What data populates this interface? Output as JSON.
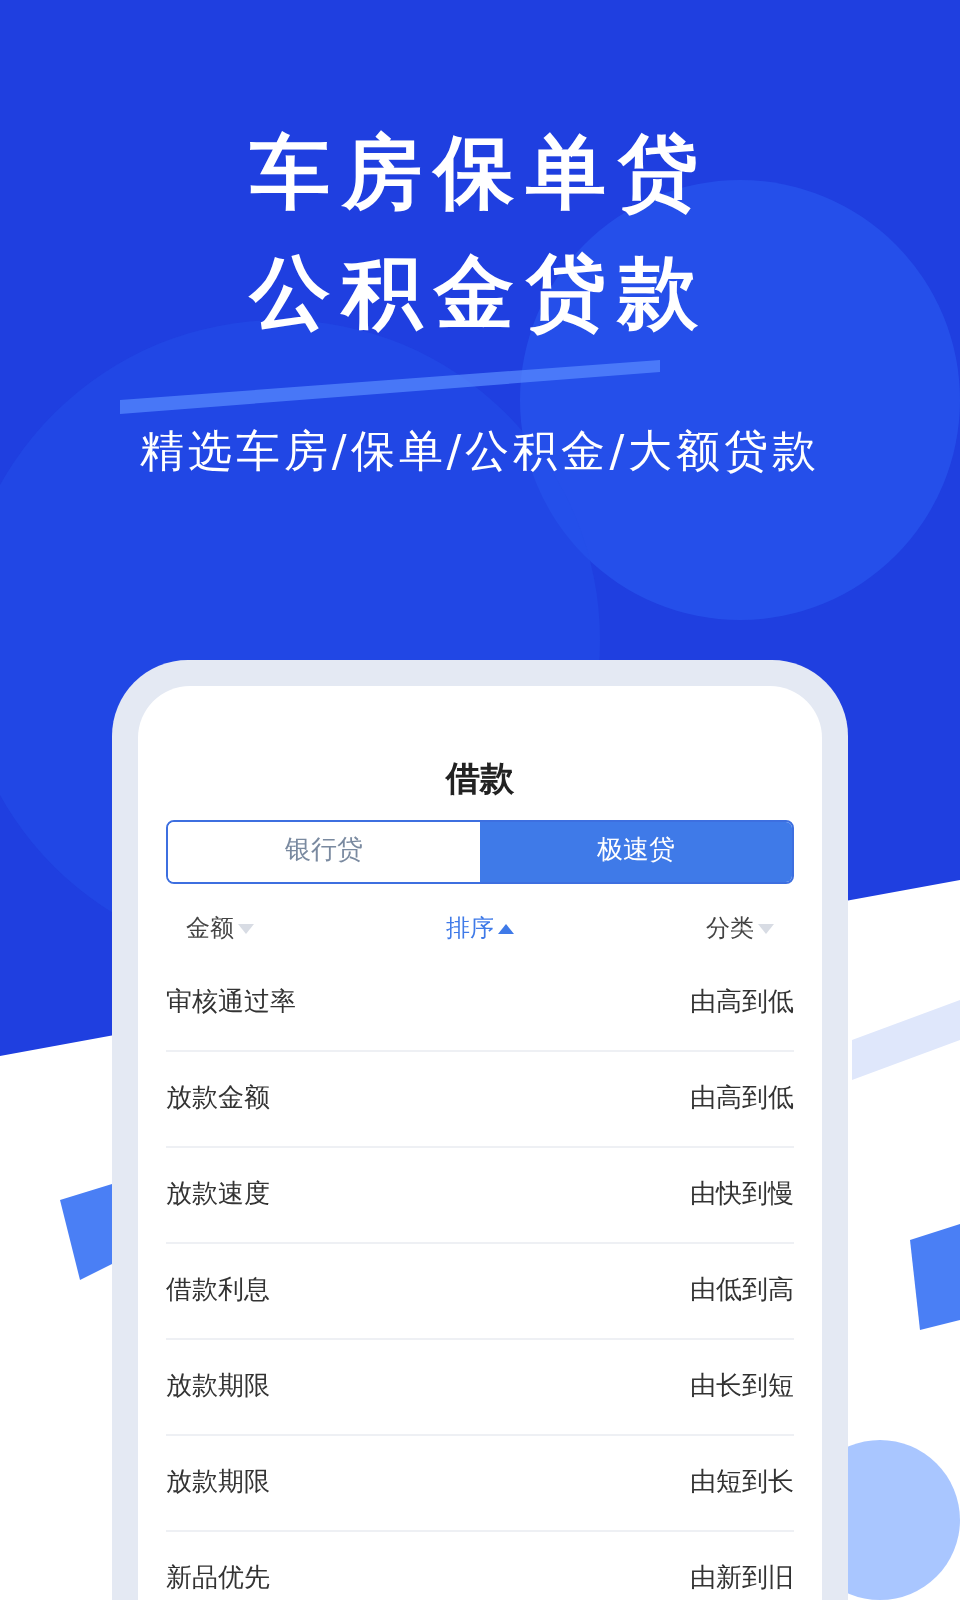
{
  "headline": [
    "车房保单贷",
    "公积金贷款"
  ],
  "subtitle": "精选车房/保单/公积金/大额贷款",
  "screen": {
    "title": "借款",
    "tabs": [
      {
        "label": "银行贷",
        "selected": false
      },
      {
        "label": "极速贷",
        "selected": true
      }
    ],
    "filters": [
      {
        "label": "金额",
        "selected": false
      },
      {
        "label": "排序",
        "selected": true
      },
      {
        "label": "分类",
        "selected": false
      }
    ],
    "rows": [
      {
        "label": "审核通过率",
        "value": "由高到低"
      },
      {
        "label": "放款金额",
        "value": "由高到低"
      },
      {
        "label": "放款速度",
        "value": "由快到慢"
      },
      {
        "label": "借款利息",
        "value": "由低到高"
      },
      {
        "label": "放款期限",
        "value": "由长到短"
      },
      {
        "label": "放款期限",
        "value": "由短到长"
      },
      {
        "label": "新品优先",
        "value": "由新到旧"
      }
    ]
  }
}
